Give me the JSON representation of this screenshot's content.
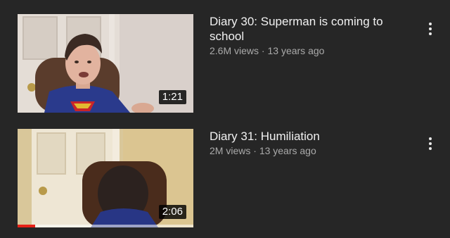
{
  "videos": [
    {
      "title": "Diary 30: Superman is coming to school",
      "views": "2.6M views",
      "separator": "·",
      "age": "13 years ago",
      "duration": "1:21",
      "menu_icon": "more-vert-icon"
    },
    {
      "title": "Diary 31: Humiliation",
      "views": "2M views",
      "separator": "·",
      "age": "13 years ago",
      "duration": "2:06",
      "watch_progress": 0.1,
      "menu_icon": "more-vert-icon"
    }
  ],
  "colors": {
    "background": "#262626",
    "title_text": "#f1f1f1",
    "secondary_text": "#aaaaaa",
    "progress": "#e62117"
  }
}
